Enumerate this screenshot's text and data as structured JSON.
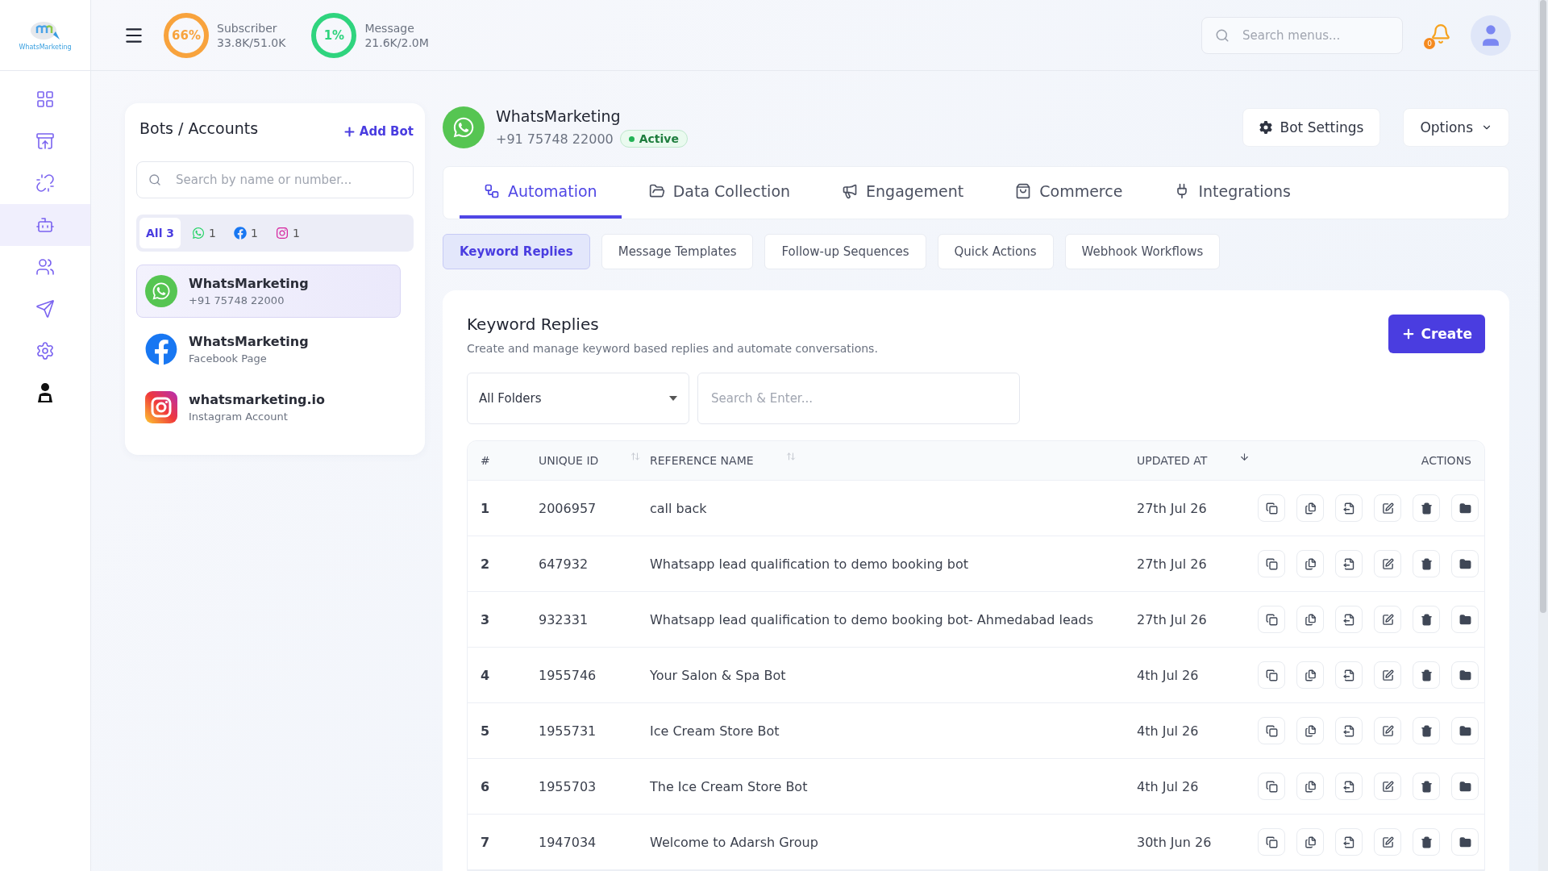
{
  "logo": {
    "text": "WhatsMarketing"
  },
  "stats": [
    {
      "percent": "66%",
      "label": "Subscriber",
      "value": "33.8K/51.0K",
      "color": "#f8a33d"
    },
    {
      "percent": "1%",
      "label": "Message",
      "value": "21.6K/2.0M",
      "color": "#2fd47e"
    }
  ],
  "search": {
    "placeholder": "Search menus..."
  },
  "notifications": {
    "count": "0"
  },
  "nav": [
    {
      "kind": "grid",
      "selected": false
    },
    {
      "kind": "inbox",
      "selected": false
    },
    {
      "kind": "link",
      "selected": false
    },
    {
      "kind": "bot",
      "selected": true
    },
    {
      "kind": "users",
      "selected": false
    },
    {
      "kind": "send",
      "selected": false
    },
    {
      "kind": "settings",
      "selected": false
    },
    {
      "kind": "agent",
      "selected": false
    }
  ],
  "bots_panel": {
    "title": "Bots / Accounts",
    "add_label": "Add Bot",
    "search_placeholder": "Search by name or number...",
    "filters": [
      {
        "kind": "all",
        "label": "All 3",
        "selected": true
      },
      {
        "kind": "whatsapp",
        "label": "1",
        "selected": false
      },
      {
        "kind": "facebook",
        "label": "1",
        "selected": false
      },
      {
        "kind": "instagram",
        "label": "1",
        "selected": false
      }
    ],
    "accounts": [
      {
        "kind": "whatsapp",
        "name": "WhatsMarketing",
        "detail": "+91 75748 22000",
        "selected": true
      },
      {
        "kind": "facebook",
        "name": "WhatsMarketing",
        "detail": "Facebook Page",
        "selected": false
      },
      {
        "kind": "instagram",
        "name": "whatsmarketing.io",
        "detail": "Instagram Account",
        "selected": false
      }
    ]
  },
  "bot": {
    "name": "WhatsMarketing",
    "phone": "+91 75748 22000",
    "status": "Active"
  },
  "header_buttons": [
    {
      "kind": "settings",
      "label": "Bot Settings"
    },
    {
      "kind": "dropdown",
      "label": "Options"
    }
  ],
  "tabs": [
    {
      "kind": "automation",
      "label": "Automation",
      "selected": true
    },
    {
      "kind": "folder",
      "label": "Data Collection",
      "selected": false
    },
    {
      "kind": "megaphone",
      "label": "Engagement",
      "selected": false
    },
    {
      "kind": "bag",
      "label": "Commerce",
      "selected": false
    },
    {
      "kind": "plug",
      "label": "Integrations",
      "selected": false
    }
  ],
  "subtabs": [
    {
      "label": "Keyword Replies",
      "selected": true
    },
    {
      "label": "Message Templates",
      "selected": false
    },
    {
      "label": "Follow-up Sequences",
      "selected": false
    },
    {
      "label": "Quick Actions",
      "selected": false
    },
    {
      "label": "Webhook Workflows",
      "selected": false
    }
  ],
  "section": {
    "title": "Keyword Replies",
    "description": "Create and manage keyword based replies and automate conversations.",
    "create_label": "Create"
  },
  "folder_select": {
    "value": "All Folders"
  },
  "table_search": {
    "placeholder": "Search & Enter..."
  },
  "table": {
    "columns": [
      {
        "label": "#",
        "sortable": false
      },
      {
        "label": "UNIQUE ID",
        "sortable": true,
        "sorted": false
      },
      {
        "label": "REFERENCE NAME",
        "sortable": true,
        "sorted": false
      },
      {
        "label": "UPDATED AT",
        "sortable": true,
        "sorted": true
      },
      {
        "label": "ACTIONS",
        "sortable": false
      }
    ],
    "rows": [
      {
        "index": "1",
        "id": "2006957",
        "name": "call back",
        "updated": "27th Jul 26"
      },
      {
        "index": "2",
        "id": "647932",
        "name": "Whatsapp lead qualification to demo booking bot",
        "updated": "27th Jul 26"
      },
      {
        "index": "3",
        "id": "932331",
        "name": "Whatsapp lead qualification to demo booking bot- Ahmedabad leads",
        "updated": "27th Jul 26"
      },
      {
        "index": "4",
        "id": "1955746",
        "name": "Your Salon & Spa Bot",
        "updated": "4th Jul 26"
      },
      {
        "index": "5",
        "id": "1955731",
        "name": "Ice Cream Store Bot",
        "updated": "4th Jul 26"
      },
      {
        "index": "6",
        "id": "1955703",
        "name": "The Ice Cream Store Bot",
        "updated": "4th Jul 26"
      },
      {
        "index": "7",
        "id": "1947034",
        "name": "Welcome to Adarsh Group",
        "updated": "30th Jun 26"
      }
    ]
  }
}
